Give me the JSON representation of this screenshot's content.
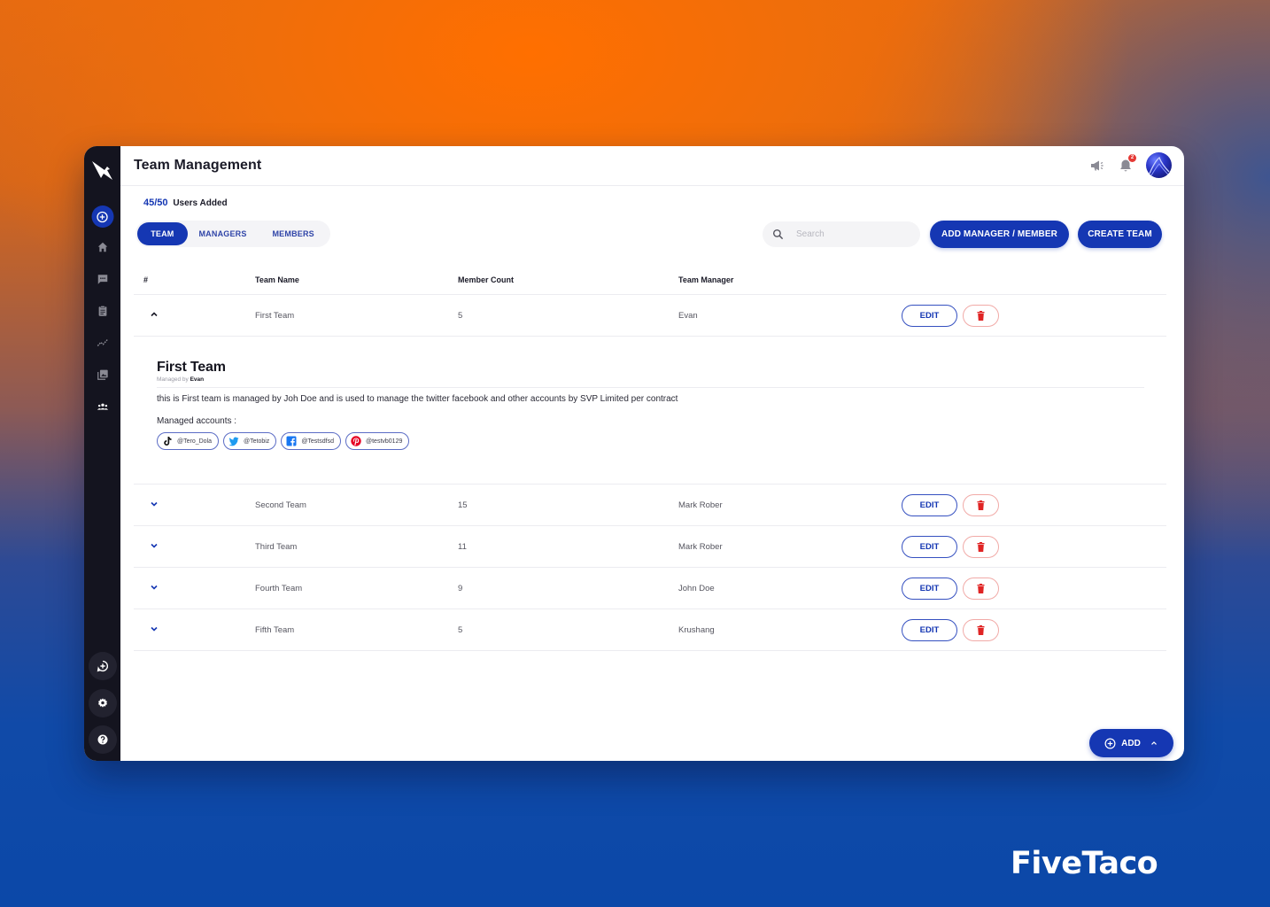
{
  "header": {
    "title": "Team Management",
    "notification_count": "2"
  },
  "users_added": {
    "count": "45/50",
    "label": "Users Added"
  },
  "tabs": [
    {
      "label": "TEAM",
      "active": true
    },
    {
      "label": "MANAGERS",
      "active": false
    },
    {
      "label": "MEMBERS",
      "active": false
    }
  ],
  "search": {
    "placeholder": "Search",
    "value": ""
  },
  "toolbar": {
    "add_manager_member_label": "ADD MANAGER / MEMBER",
    "create_team_label": "CREATE TEAM"
  },
  "table": {
    "columns": [
      "#",
      "Team Name",
      "Member Count",
      "Team Manager"
    ],
    "rows": [
      {
        "name": "First Team",
        "count": "5",
        "manager": "Evan",
        "expanded": true,
        "edit_label": "EDIT"
      },
      {
        "name": "Second Team",
        "count": "15",
        "manager": "Mark Rober",
        "expanded": false,
        "edit_label": "EDIT"
      },
      {
        "name": "Third Team",
        "count": "11",
        "manager": "Mark Rober",
        "expanded": false,
        "edit_label": "EDIT"
      },
      {
        "name": "Fourth Team",
        "count": "9",
        "manager": "John Doe",
        "expanded": false,
        "edit_label": "EDIT"
      },
      {
        "name": "Fifth Team",
        "count": "5",
        "manager": "Krushang",
        "expanded": false,
        "edit_label": "EDIT"
      }
    ]
  },
  "detail": {
    "title": "First Team",
    "managed_by_prefix": "Managed by",
    "managed_by": "Evan",
    "description": "this is First team is managed by Joh Doe and is used to manage the twitter facebook and other accounts by SVP Limited per contract",
    "accounts_label": "Managed accounts :",
    "accounts": [
      {
        "platform": "tiktok-icon",
        "handle": "@Tero_Dola"
      },
      {
        "platform": "twitter-icon",
        "handle": "@Tetobiz"
      },
      {
        "platform": "facebook-icon",
        "handle": "@Testsdfsd"
      },
      {
        "platform": "pinterest-icon",
        "handle": "@testvb0129"
      }
    ]
  },
  "fab": {
    "label": "ADD"
  },
  "sidebar": {
    "items": [
      {
        "icon": "add-circle-icon",
        "active": true
      },
      {
        "icon": "home-icon"
      },
      {
        "icon": "chat-icon"
      },
      {
        "icon": "clipboard-icon"
      },
      {
        "icon": "analytics-icon"
      },
      {
        "icon": "media-library-icon"
      },
      {
        "icon": "team-icon",
        "selected": true
      }
    ],
    "bottom": [
      {
        "icon": "add-chat-icon"
      },
      {
        "icon": "settings-icon"
      },
      {
        "icon": "help-icon"
      }
    ]
  },
  "colors": {
    "primary": "#1537b3",
    "sidebar": "#14141f",
    "danger": "#e53935"
  },
  "brand": "FiveTaco"
}
